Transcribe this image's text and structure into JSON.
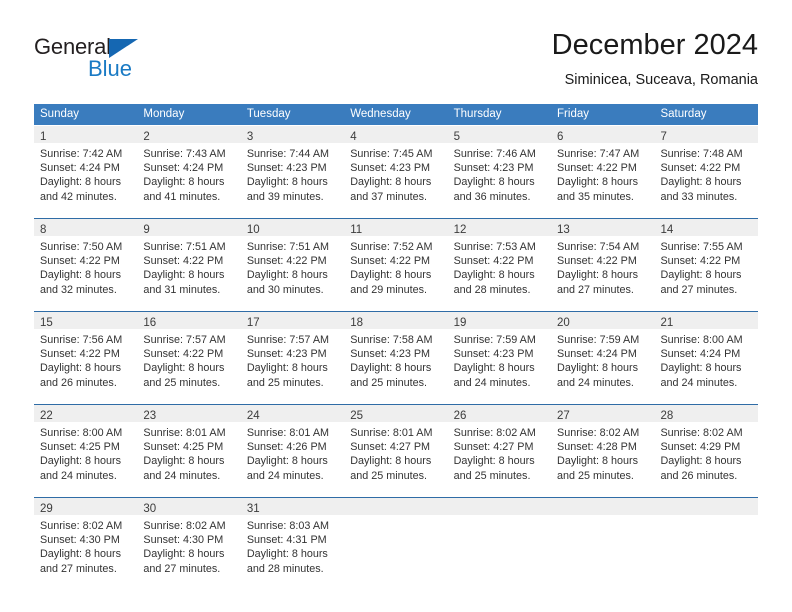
{
  "brand": {
    "name_top": "General",
    "name_bottom": "Blue",
    "triangle_color": "#1567b2",
    "blue_color": "#1a7ac4"
  },
  "header": {
    "title": "December 2024",
    "subtitle": "Siminicea, Suceava, Romania"
  },
  "theme": {
    "header_bg": "#3a7cbe",
    "header_text": "#ffffff",
    "day_band_bg": "#efefef",
    "row_border": "#2f6ca6",
    "body_text": "#333333"
  },
  "weekdays": [
    "Sunday",
    "Monday",
    "Tuesday",
    "Wednesday",
    "Thursday",
    "Friday",
    "Saturday"
  ],
  "weeks": [
    [
      {
        "day": "1",
        "sunrise": "Sunrise: 7:42 AM",
        "sunset": "Sunset: 4:24 PM",
        "daylight1": "Daylight: 8 hours",
        "daylight2": "and 42 minutes."
      },
      {
        "day": "2",
        "sunrise": "Sunrise: 7:43 AM",
        "sunset": "Sunset: 4:24 PM",
        "daylight1": "Daylight: 8 hours",
        "daylight2": "and 41 minutes."
      },
      {
        "day": "3",
        "sunrise": "Sunrise: 7:44 AM",
        "sunset": "Sunset: 4:23 PM",
        "daylight1": "Daylight: 8 hours",
        "daylight2": "and 39 minutes."
      },
      {
        "day": "4",
        "sunrise": "Sunrise: 7:45 AM",
        "sunset": "Sunset: 4:23 PM",
        "daylight1": "Daylight: 8 hours",
        "daylight2": "and 37 minutes."
      },
      {
        "day": "5",
        "sunrise": "Sunrise: 7:46 AM",
        "sunset": "Sunset: 4:23 PM",
        "daylight1": "Daylight: 8 hours",
        "daylight2": "and 36 minutes."
      },
      {
        "day": "6",
        "sunrise": "Sunrise: 7:47 AM",
        "sunset": "Sunset: 4:22 PM",
        "daylight1": "Daylight: 8 hours",
        "daylight2": "and 35 minutes."
      },
      {
        "day": "7",
        "sunrise": "Sunrise: 7:48 AM",
        "sunset": "Sunset: 4:22 PM",
        "daylight1": "Daylight: 8 hours",
        "daylight2": "and 33 minutes."
      }
    ],
    [
      {
        "day": "8",
        "sunrise": "Sunrise: 7:50 AM",
        "sunset": "Sunset: 4:22 PM",
        "daylight1": "Daylight: 8 hours",
        "daylight2": "and 32 minutes."
      },
      {
        "day": "9",
        "sunrise": "Sunrise: 7:51 AM",
        "sunset": "Sunset: 4:22 PM",
        "daylight1": "Daylight: 8 hours",
        "daylight2": "and 31 minutes."
      },
      {
        "day": "10",
        "sunrise": "Sunrise: 7:51 AM",
        "sunset": "Sunset: 4:22 PM",
        "daylight1": "Daylight: 8 hours",
        "daylight2": "and 30 minutes."
      },
      {
        "day": "11",
        "sunrise": "Sunrise: 7:52 AM",
        "sunset": "Sunset: 4:22 PM",
        "daylight1": "Daylight: 8 hours",
        "daylight2": "and 29 minutes."
      },
      {
        "day": "12",
        "sunrise": "Sunrise: 7:53 AM",
        "sunset": "Sunset: 4:22 PM",
        "daylight1": "Daylight: 8 hours",
        "daylight2": "and 28 minutes."
      },
      {
        "day": "13",
        "sunrise": "Sunrise: 7:54 AM",
        "sunset": "Sunset: 4:22 PM",
        "daylight1": "Daylight: 8 hours",
        "daylight2": "and 27 minutes."
      },
      {
        "day": "14",
        "sunrise": "Sunrise: 7:55 AM",
        "sunset": "Sunset: 4:22 PM",
        "daylight1": "Daylight: 8 hours",
        "daylight2": "and 27 minutes."
      }
    ],
    [
      {
        "day": "15",
        "sunrise": "Sunrise: 7:56 AM",
        "sunset": "Sunset: 4:22 PM",
        "daylight1": "Daylight: 8 hours",
        "daylight2": "and 26 minutes."
      },
      {
        "day": "16",
        "sunrise": "Sunrise: 7:57 AM",
        "sunset": "Sunset: 4:22 PM",
        "daylight1": "Daylight: 8 hours",
        "daylight2": "and 25 minutes."
      },
      {
        "day": "17",
        "sunrise": "Sunrise: 7:57 AM",
        "sunset": "Sunset: 4:23 PM",
        "daylight1": "Daylight: 8 hours",
        "daylight2": "and 25 minutes."
      },
      {
        "day": "18",
        "sunrise": "Sunrise: 7:58 AM",
        "sunset": "Sunset: 4:23 PM",
        "daylight1": "Daylight: 8 hours",
        "daylight2": "and 25 minutes."
      },
      {
        "day": "19",
        "sunrise": "Sunrise: 7:59 AM",
        "sunset": "Sunset: 4:23 PM",
        "daylight1": "Daylight: 8 hours",
        "daylight2": "and 24 minutes."
      },
      {
        "day": "20",
        "sunrise": "Sunrise: 7:59 AM",
        "sunset": "Sunset: 4:24 PM",
        "daylight1": "Daylight: 8 hours",
        "daylight2": "and 24 minutes."
      },
      {
        "day": "21",
        "sunrise": "Sunrise: 8:00 AM",
        "sunset": "Sunset: 4:24 PM",
        "daylight1": "Daylight: 8 hours",
        "daylight2": "and 24 minutes."
      }
    ],
    [
      {
        "day": "22",
        "sunrise": "Sunrise: 8:00 AM",
        "sunset": "Sunset: 4:25 PM",
        "daylight1": "Daylight: 8 hours",
        "daylight2": "and 24 minutes."
      },
      {
        "day": "23",
        "sunrise": "Sunrise: 8:01 AM",
        "sunset": "Sunset: 4:25 PM",
        "daylight1": "Daylight: 8 hours",
        "daylight2": "and 24 minutes."
      },
      {
        "day": "24",
        "sunrise": "Sunrise: 8:01 AM",
        "sunset": "Sunset: 4:26 PM",
        "daylight1": "Daylight: 8 hours",
        "daylight2": "and 24 minutes."
      },
      {
        "day": "25",
        "sunrise": "Sunrise: 8:01 AM",
        "sunset": "Sunset: 4:27 PM",
        "daylight1": "Daylight: 8 hours",
        "daylight2": "and 25 minutes."
      },
      {
        "day": "26",
        "sunrise": "Sunrise: 8:02 AM",
        "sunset": "Sunset: 4:27 PM",
        "daylight1": "Daylight: 8 hours",
        "daylight2": "and 25 minutes."
      },
      {
        "day": "27",
        "sunrise": "Sunrise: 8:02 AM",
        "sunset": "Sunset: 4:28 PM",
        "daylight1": "Daylight: 8 hours",
        "daylight2": "and 25 minutes."
      },
      {
        "day": "28",
        "sunrise": "Sunrise: 8:02 AM",
        "sunset": "Sunset: 4:29 PM",
        "daylight1": "Daylight: 8 hours",
        "daylight2": "and 26 minutes."
      }
    ],
    [
      {
        "day": "29",
        "sunrise": "Sunrise: 8:02 AM",
        "sunset": "Sunset: 4:30 PM",
        "daylight1": "Daylight: 8 hours",
        "daylight2": "and 27 minutes."
      },
      {
        "day": "30",
        "sunrise": "Sunrise: 8:02 AM",
        "sunset": "Sunset: 4:30 PM",
        "daylight1": "Daylight: 8 hours",
        "daylight2": "and 27 minutes."
      },
      {
        "day": "31",
        "sunrise": "Sunrise: 8:03 AM",
        "sunset": "Sunset: 4:31 PM",
        "daylight1": "Daylight: 8 hours",
        "daylight2": "and 28 minutes."
      },
      {
        "day": "",
        "sunrise": "",
        "sunset": "",
        "daylight1": "",
        "daylight2": ""
      },
      {
        "day": "",
        "sunrise": "",
        "sunset": "",
        "daylight1": "",
        "daylight2": ""
      },
      {
        "day": "",
        "sunrise": "",
        "sunset": "",
        "daylight1": "",
        "daylight2": ""
      },
      {
        "day": "",
        "sunrise": "",
        "sunset": "",
        "daylight1": "",
        "daylight2": ""
      }
    ]
  ]
}
